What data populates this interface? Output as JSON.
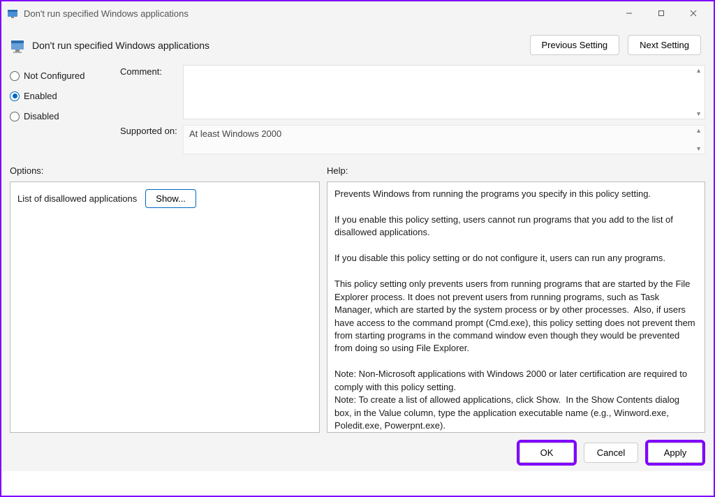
{
  "window": {
    "title": "Don't run specified Windows applications"
  },
  "header": {
    "title": "Don't run specified Windows applications",
    "prev": "Previous Setting",
    "next": "Next Setting"
  },
  "state": {
    "options": [
      {
        "label": "Not Configured",
        "checked": false
      },
      {
        "label": "Enabled",
        "checked": true
      },
      {
        "label": "Disabled",
        "checked": false
      }
    ]
  },
  "labels": {
    "comment": "Comment:",
    "supported": "Supported on:",
    "options": "Options:",
    "help": "Help:"
  },
  "fields": {
    "comment_value": "",
    "supported_value": "At least Windows 2000"
  },
  "options_pane": {
    "line": "List of disallowed applications",
    "show": "Show..."
  },
  "help_text": "Prevents Windows from running the programs you specify in this policy setting.\n\nIf you enable this policy setting, users cannot run programs that you add to the list of disallowed applications.\n\nIf you disable this policy setting or do not configure it, users can run any programs.\n\nThis policy setting only prevents users from running programs that are started by the File Explorer process. It does not prevent users from running programs, such as Task Manager, which are started by the system process or by other processes.  Also, if users have access to the command prompt (Cmd.exe), this policy setting does not prevent them from starting programs in the command window even though they would be prevented from doing so using File Explorer.\n\nNote: Non-Microsoft applications with Windows 2000 or later certification are required to comply with this policy setting.\nNote: To create a list of allowed applications, click Show.  In the Show Contents dialog box, in the Value column, type the application executable name (e.g., Winword.exe, Poledit.exe, Powerpnt.exe).",
  "buttons": {
    "ok": "OK",
    "cancel": "Cancel",
    "apply": "Apply"
  }
}
